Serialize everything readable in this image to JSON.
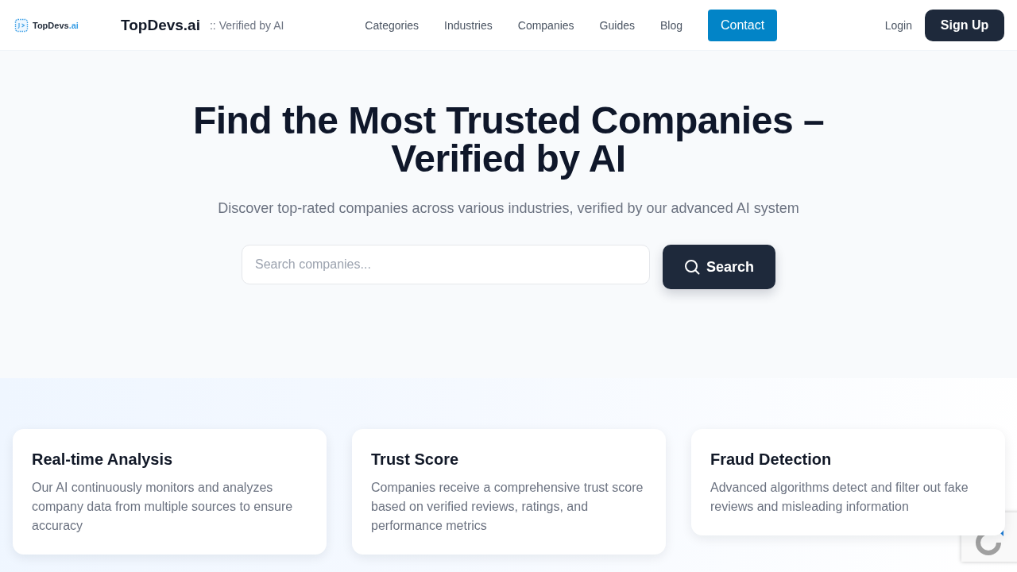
{
  "header": {
    "logo": {
      "name": "TopDevs",
      "accent": ".ai"
    },
    "brand": "TopDevs.ai",
    "tagline": ":: Verified by AI",
    "nav": [
      "Categories",
      "Industries",
      "Companies",
      "Guides",
      "Blog"
    ],
    "contact": "Contact",
    "login": "Login",
    "signup": "Sign Up"
  },
  "hero": {
    "title": "Find the Most Trusted Companies – Verified by AI",
    "subtitle": "Discover top-rated companies across various industries, verified by our advanced AI system",
    "search": {
      "placeholder": "Search companies...",
      "button": "Search"
    }
  },
  "features": [
    {
      "title": "Real-time Analysis",
      "description": "Our AI continuously monitors and analyzes company data from multiple sources to ensure accuracy"
    },
    {
      "title": "Trust Score",
      "description": "Companies receive a comprehensive trust score based on verified reviews, ratings, and performance metrics"
    },
    {
      "title": "Fraud Detection",
      "description": "Advanced algorithms detect and filter out fake reviews and misleading information"
    }
  ]
}
